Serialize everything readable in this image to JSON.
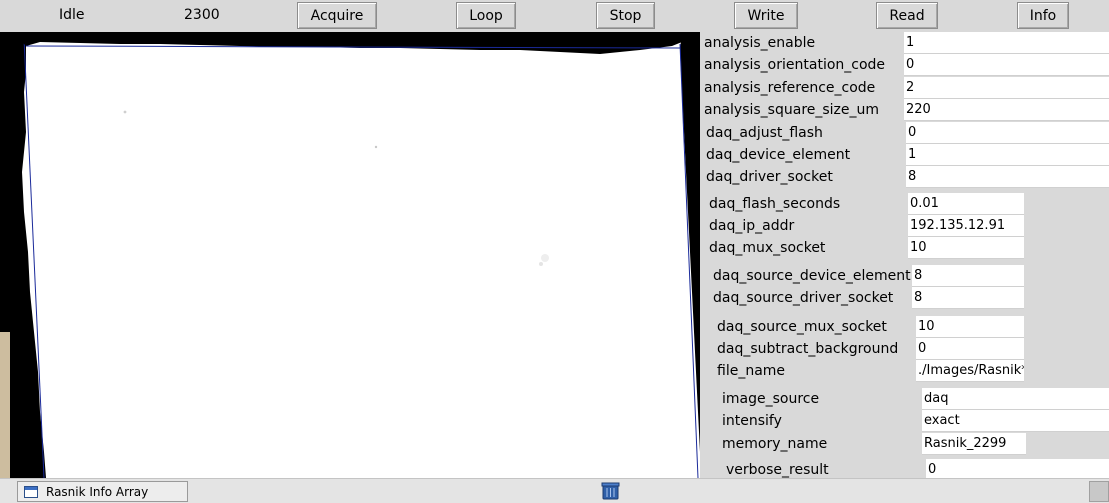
{
  "toolbar": {
    "status": "Idle",
    "counter": "2300",
    "buttons": {
      "acquire": "Acquire",
      "loop": "Loop",
      "stop": "Stop",
      "write": "Write",
      "read": "Read",
      "info": "Info"
    }
  },
  "params": [
    {
      "name": "analysis_enable",
      "value": "1"
    },
    {
      "name": "analysis_orientation_code",
      "value": "0"
    },
    {
      "name": "analysis_reference_code",
      "value": "2"
    },
    {
      "name": "analysis_square_size_um",
      "value": "220"
    },
    {
      "name": "daq_adjust_flash",
      "value": "0"
    },
    {
      "name": "daq_device_element",
      "value": "1"
    },
    {
      "name": "daq_driver_socket",
      "value": "8"
    },
    {
      "name": "daq_flash_seconds",
      "value": "0.01"
    },
    {
      "name": "daq_ip_addr",
      "value": "192.135.12.91"
    },
    {
      "name": "daq_mux_socket",
      "value": "10"
    },
    {
      "name": "daq_source_device_element",
      "value": "8"
    },
    {
      "name": "daq_source_driver_socket",
      "value": "8"
    },
    {
      "name": "daq_source_mux_socket",
      "value": "10"
    },
    {
      "name": "daq_subtract_background",
      "value": "0"
    },
    {
      "name": "file_name",
      "value": "./Images/Rasnik*"
    },
    {
      "name": "image_source",
      "value": "daq"
    },
    {
      "name": "intensify",
      "value": "exact"
    },
    {
      "name": "memory_name",
      "value": "Rasnik_2299"
    },
    {
      "name": "verbose_result",
      "value": "0"
    }
  ],
  "taskbar": {
    "window_label": "Rasnik Info Array",
    "window_icon": "window-icon",
    "trash_icon": "trash-icon"
  }
}
